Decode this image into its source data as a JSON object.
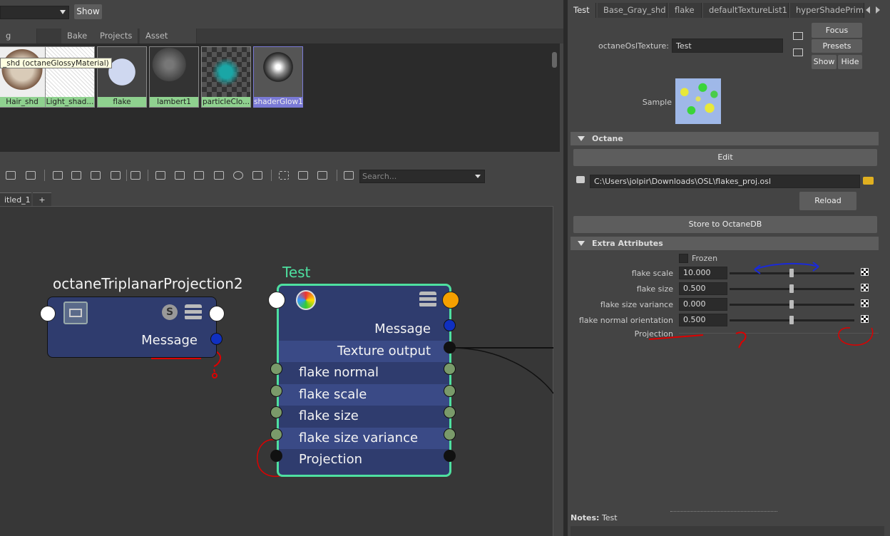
{
  "top": {
    "show_label": "Show"
  },
  "browser_tabs": [
    "g Groups",
    "Bake Sets",
    "Projects",
    "Asset Nodes"
  ],
  "swatches": [
    {
      "label": "Hair_shd"
    },
    {
      "label": "Light_shad..."
    },
    {
      "label": "flake"
    },
    {
      "label": "lambert1"
    },
    {
      "label": "particleClo..."
    },
    {
      "label": "shaderGlow1"
    }
  ],
  "tooltip": "_shd (octaneGlossyMaterial)",
  "search": {
    "placeholder": "Search..."
  },
  "graph_tabs": [
    "itled_1",
    "+"
  ],
  "nodes": {
    "triplanar": {
      "title": "octaneTriplanarProjection2",
      "message": "Message"
    },
    "test": {
      "title": "Test",
      "rows": [
        "Message",
        "Texture output",
        "flake normal orientation",
        "flake scale",
        "flake size",
        "flake size variance",
        "Projection"
      ]
    }
  },
  "ae": {
    "tabs": [
      "Test",
      "Base_Gray_shd",
      "flake",
      "defaultTextureList1",
      "hyperShadePrimar"
    ],
    "type_label": "octaneOslTexture:",
    "name_value": "Test",
    "focus": "Focus",
    "presets": "Presets",
    "show": "Show",
    "hide": "Hide",
    "sample": "Sample",
    "section_octane": "Octane",
    "edit": "Edit",
    "path": "C:\\Users\\jolpir\\Downloads\\OSL\\flakes_proj.osl",
    "reload": "Reload",
    "store": "Store to OctaneDB",
    "section_extra": "Extra Attributes",
    "frozen": "Frozen",
    "attrs": [
      {
        "label": "flake scale",
        "value": "10.000"
      },
      {
        "label": "flake size",
        "value": "0.500"
      },
      {
        "label": "flake size variance",
        "value": "0.000"
      },
      {
        "label": "flake normal orientation",
        "value": "0.500"
      }
    ],
    "projection": "Projection",
    "notes_label": "Notes:",
    "notes_value": "Test"
  },
  "annotation": {
    "question": "?"
  },
  "colors": {
    "node_body": "#2f3c6e",
    "node_alt_row": "#3a4a86",
    "test_border": "#4ee0a0",
    "accent_orange": "#f5a000",
    "swatch_label": "#8fd18f"
  }
}
